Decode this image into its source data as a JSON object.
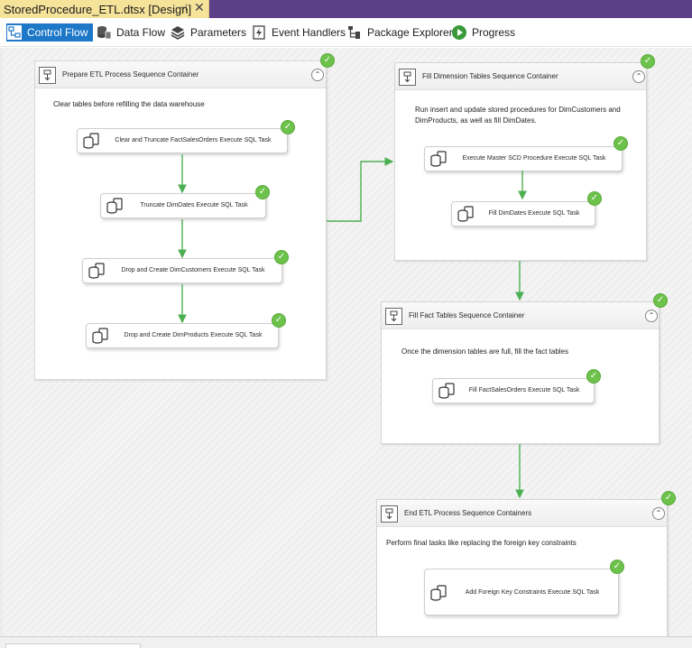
{
  "document_tab": {
    "title": "StoredProcedure_ETL.dtsx [Design]",
    "pin_glyph": "⊣",
    "close_glyph": "✕"
  },
  "toolbar": {
    "items": [
      {
        "label": "Control Flow",
        "icon": "control-flow-icon",
        "active": true
      },
      {
        "label": "Data Flow",
        "icon": "data-flow-icon"
      },
      {
        "label": "Parameters",
        "icon": "parameters-icon"
      },
      {
        "label": "Event Handlers",
        "icon": "event-handlers-icon"
      },
      {
        "label": "Package Explorer",
        "icon": "package-explorer-icon"
      },
      {
        "label": "Progress",
        "icon": "progress-icon"
      }
    ]
  },
  "colors": {
    "title_bar": "#5b3f87",
    "document_tab": "#f6e39a",
    "active_tab": "#1e78c8",
    "success_check": "#6cc24a",
    "precedence_arrow": "#4caf50"
  },
  "containers": [
    {
      "title": "Prepare ETL Process Sequence Container",
      "note": "Clear tables before refilling the data warehouse",
      "status": "success",
      "tasks": [
        {
          "label": "Clear and Truncate FactSalesOrders Execute SQL Task",
          "status": "success"
        },
        {
          "label": "Truncate DimDates Execute SQL Task",
          "status": "success"
        },
        {
          "label": "Drop and Create DimCustomers Execute SQL Task",
          "status": "success"
        },
        {
          "label": "Drop and Create DimProducts Execute SQL Task",
          "status": "success"
        }
      ]
    },
    {
      "title": "Fill Dimension Tables Sequence Container",
      "note": "Run insert and update stored procedures for DimCustomers and DimProducts, as well as fill DimDates.",
      "status": "success",
      "tasks": [
        {
          "label": "Execute Master SCD Procedure Execute SQL Task",
          "status": "success"
        },
        {
          "label": "Fill DimDates Execute SQL Task",
          "status": "success"
        }
      ]
    },
    {
      "title": "Fill Fact Tables Sequence Container",
      "note": "Once the dimension tables are full, fill the fact tables",
      "status": "success",
      "tasks": [
        {
          "label": "Fill FactSalesOrders Execute SQL Task",
          "status": "success"
        }
      ]
    },
    {
      "title": "End ETL Process Sequence Containers",
      "note": "Perform final tasks like replacing the foreign key constraints",
      "status": "success",
      "tasks": [
        {
          "label": "Add Foreign Key Constraints Execute SQL Task",
          "status": "success"
        }
      ]
    }
  ],
  "collapse_glyph": "⌃",
  "check_glyph": "✓"
}
